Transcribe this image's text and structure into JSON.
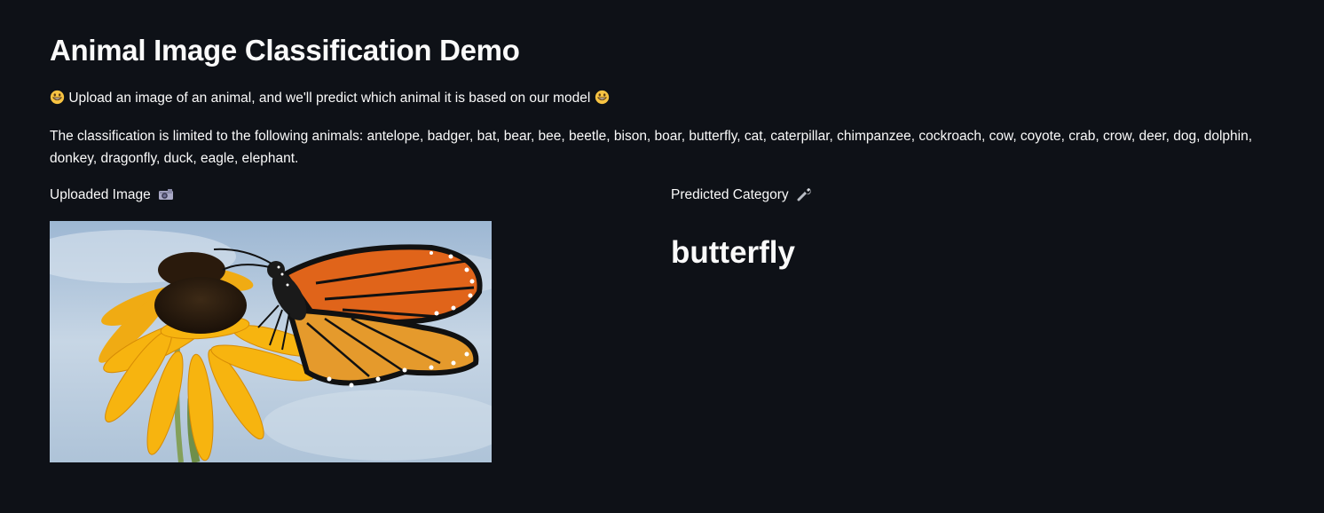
{
  "app": {
    "title": "Animal Image Classification Demo",
    "intro_emoji_name": "grinning-face-icon",
    "intro_text": "Upload an image of an animal, and we'll predict which animal it is based on our model",
    "limits_text": "The classification is limited to the following animals: antelope, badger, bat, bear, bee, beetle, bison, boar, butterfly, cat, caterpillar, chimpanzee, cockroach, cow, coyote, crab, crow, deer, dog, dolphin, donkey, dragonfly, duck, eagle, elephant."
  },
  "left_column": {
    "label": "Uploaded Image",
    "label_icon": "camera-icon",
    "image_subject": "monarch butterfly on yellow flower"
  },
  "right_column": {
    "label": "Predicted Category",
    "label_icon": "wrench-icon",
    "prediction": "butterfly"
  },
  "colors": {
    "background": "#0e1117",
    "text": "#fafafa"
  }
}
